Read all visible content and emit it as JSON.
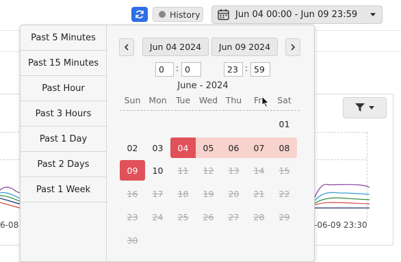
{
  "header": {
    "history_label": "History",
    "range_label": "Jun 04 00:00 - Jun 09 23:59"
  },
  "chart_axis": {
    "left_tick": "6-08",
    "right_tick": "-06-09 23:30"
  },
  "presets": [
    "Past 5 Minutes",
    "Past 15 Minutes",
    "Past Hour",
    "Past 3 Hours",
    "Past 1 Day",
    "Past 2 Days",
    "Past 1 Week"
  ],
  "calendar": {
    "start_date": "Jun 04 2024",
    "end_date": "Jun 09 2024",
    "start_hour": "0",
    "start_minute": "0",
    "end_hour": "23",
    "end_minute": "59",
    "time_separator": ":",
    "month_label": "June - 2024",
    "weekdays": [
      "Sun",
      "Mon",
      "Tue",
      "Wed",
      "Thu",
      "Fri",
      "Sat"
    ],
    "weeks": [
      [
        null,
        null,
        null,
        null,
        null,
        null,
        "01"
      ],
      [
        "02",
        "03",
        "04",
        "05",
        "06",
        "07",
        "08"
      ],
      [
        "09",
        "10",
        "11",
        "12",
        "13",
        "14",
        "15"
      ],
      [
        "16",
        "17",
        "18",
        "19",
        "20",
        "21",
        "22"
      ],
      [
        "23",
        "24",
        "25",
        "26",
        "27",
        "28",
        "29"
      ],
      [
        "30",
        null,
        null,
        null,
        null,
        null,
        null
      ]
    ],
    "selected_start_day": "04",
    "selected_end_day": "09",
    "last_enabled_day": "10"
  },
  "colors": {
    "accent_blue": "#2e6ee6",
    "selection_red": "#e0515a",
    "range_pink": "#f8d3cd"
  },
  "icons": {
    "refresh": "refresh-icon",
    "calendar": "calendar-icon",
    "filter": "filter-icon",
    "prev": "chevron-left-icon",
    "next": "chevron-right-icon"
  }
}
